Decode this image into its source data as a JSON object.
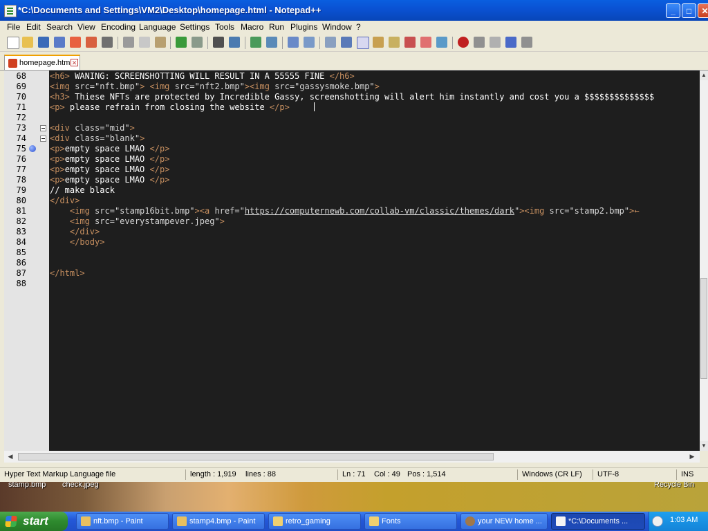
{
  "window": {
    "title": "*C:\\Documents and Settings\\VM2\\Desktop\\homepage.html - Notepad++"
  },
  "menu": [
    "File",
    "Edit",
    "Search",
    "View",
    "Encoding",
    "Language",
    "Settings",
    "Tools",
    "Macro",
    "Run",
    "Plugins",
    "Window",
    "?"
  ],
  "tab": {
    "label": "homepage.html"
  },
  "editor": {
    "line_numbers": [
      "68",
      "69",
      "70",
      "71",
      "72",
      "73",
      "74",
      "75",
      "76",
      "77",
      "78",
      "79",
      "80",
      "81",
      "82",
      "83",
      "84",
      "85",
      "86",
      "87",
      "88"
    ],
    "l68": {
      "open": "<h6>",
      "text": " WANING: SCREENSHOTTING WILL RESULT IN A 55555 FINE ",
      "close": "</h6>"
    },
    "l69": {
      "t1": "<img",
      "a1": " src=",
      "s1": "\"nft.bmp\"",
      "t2": "> <img",
      "a2": " src=",
      "s2": "\"nft2.bmp\"",
      "t3": "><img",
      "a3": " src=",
      "s3": "\"gassysmoke.bmp\"",
      "t4": ">"
    },
    "l70": {
      "open": "<h3>",
      "text": " Thiese NFTs are protected by Incredible Gassy, screenshotting will alert him instantly and cost you a $$$$$$$$$$$$$$"
    },
    "l71": {
      "open": "<p>",
      "text": " please refrain from closing the website ",
      "close": "</p>"
    },
    "l73": {
      "t1": "<div",
      "a1": " class=",
      "s1": "\"mid\"",
      "t2": ">"
    },
    "l74": {
      "t1": "<div",
      "a1": " class=",
      "s1": "\"blank\"",
      "t2": ">"
    },
    "l75": {
      "open": "<p>",
      "text": "empty space LMAO ",
      "close": "</p>"
    },
    "l76": {
      "open": "<p>",
      "text": "empty space LMAO ",
      "close": "</p>"
    },
    "l77": {
      "open": "<p>",
      "text": "empty space LMAO ",
      "close": "</p>"
    },
    "l78": {
      "open": "<p>",
      "text": "empty space LMAO ",
      "close": "</p>"
    },
    "l79": {
      "text": "// make black"
    },
    "l80": {
      "text": "</div>"
    },
    "l81": {
      "indent": "    ",
      "t1": "<img",
      "a1": " src=",
      "s1": "\"stamp16bit.bmp\"",
      "t2": "><a",
      "a2": " href=",
      "q1": "\"",
      "link": "https://computernewb.com/collab-vm/classic/themes/dark",
      "q2": "\"",
      "t3": "><img",
      "a3": " src=",
      "s3": "\"stamp2.bmp\"",
      "t4": ">←"
    },
    "l82": {
      "indent": "    ",
      "t1": "<img",
      "a1": " src=",
      "s1": "\"everystampever.jpeg\"",
      "t2": ">"
    },
    "l83": {
      "text": "    </div>"
    },
    "l84": {
      "text": "    </body>"
    },
    "l87": {
      "text": "</html>"
    }
  },
  "status": {
    "file_type": "Hyper Text Markup Language file",
    "length": "length : 1,919",
    "lines": "lines : 88",
    "ln": "Ln : 71",
    "col": "Col : 49",
    "pos": "Pos : 1,514",
    "eol": "Windows (CR LF)",
    "encoding": "UTF-8",
    "mode": "INS"
  },
  "desktop": {
    "icon1": "stamp.bmp",
    "icon2": "check.jpeg",
    "icon3": "Recycle Bin"
  },
  "taskbar": {
    "start": "start",
    "tasks": [
      "nft.bmp - Paint",
      "stamp4.bmp - Paint",
      "retro_gaming",
      "Fonts",
      "your NEW home ...",
      "*C:\\Documents ..."
    ],
    "clock": "1:03 AM"
  },
  "colors": {
    "titlebar": "#0a52d4",
    "editor_bg": "#1e1e1e",
    "tag": "#c89060",
    "taskbar": "#2458d8",
    "start": "#2e8a2e"
  }
}
